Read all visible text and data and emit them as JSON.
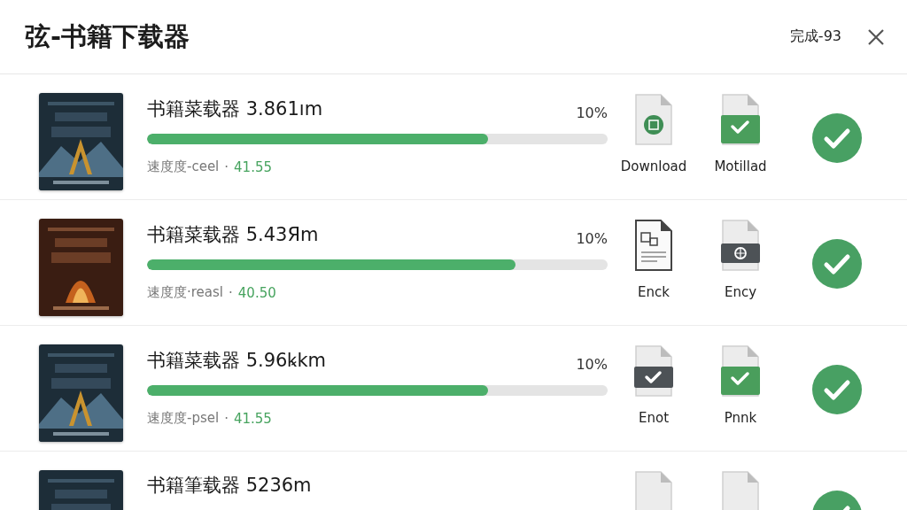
{
  "window": {
    "title": "弦-书籍下载器",
    "status": "完成-93"
  },
  "downloads": [
    {
      "title": "书籍菜载器 3.861ım",
      "percent": "10%",
      "level": 0.74,
      "speed_label": "速度度-ceel",
      "separator": "·",
      "speed": "41.55",
      "files": [
        {
          "kind": "badge",
          "label": "Download"
        },
        {
          "kind": "green-check",
          "label": "Motillad"
        }
      ],
      "done": true
    },
    {
      "title": "书籍菜载器 5.43Яm",
      "percent": "10%",
      "level": 0.8,
      "speed_label": "速度度·reasl",
      "separator": "·",
      "speed": "40.50",
      "files": [
        {
          "kind": "text",
          "label": "Enck"
        },
        {
          "kind": "dark-globe",
          "label": "Ency"
        }
      ],
      "done": true
    },
    {
      "title": "书籍菜载器 5.96ꝃkm",
      "percent": "10%",
      "level": 0.74,
      "speed_label": "速度度-psel",
      "separator": "·",
      "speed": "41.55",
      "files": [
        {
          "kind": "dark-check",
          "label": "Enot"
        },
        {
          "kind": "green-check",
          "label": "Pnnk"
        }
      ],
      "done": true
    },
    {
      "title": "书籍筆载器 5236m",
      "files": [
        {
          "kind": "plain"
        },
        {
          "kind": "plain"
        }
      ],
      "done": true
    }
  ]
}
